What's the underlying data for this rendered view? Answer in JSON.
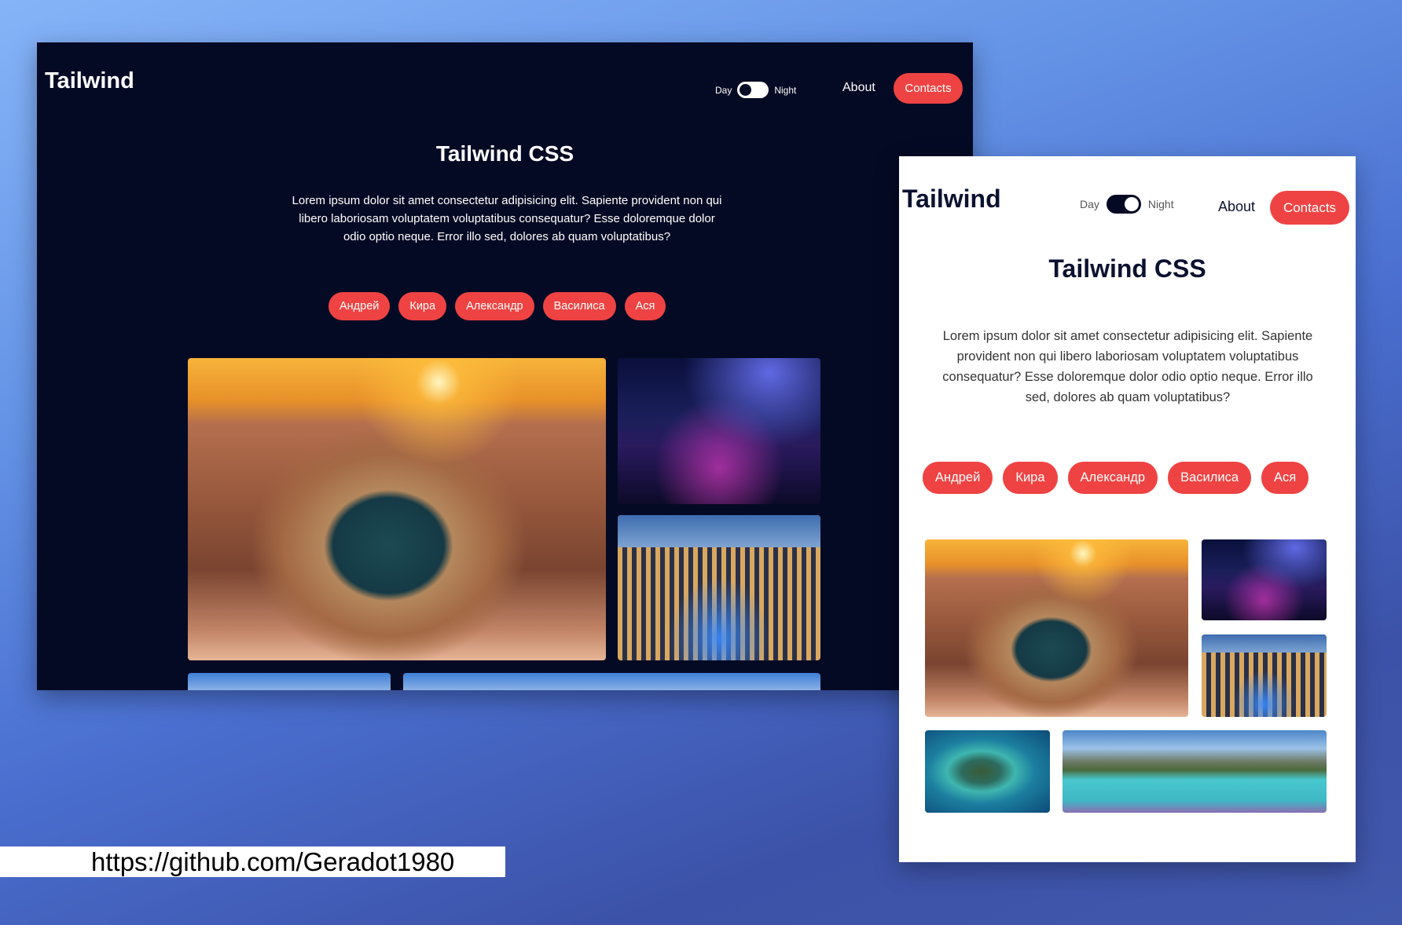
{
  "dark_window": {
    "logo": "Tailwind",
    "toggle": {
      "day_label": "Day",
      "night_label": "Night",
      "state": "night"
    },
    "nav": {
      "about": "About",
      "contacts": "Contacts"
    },
    "title": "Tailwind CSS",
    "description": "Lorem ipsum dolor sit amet consectetur adipisicing elit. Sapiente provident non qui libero laboriosam voluptatem voluptatibus consequatur? Esse doloremque dolor odio optio neque. Error illo sed, dolores ab quam voluptatibus?",
    "chips": [
      "Андрей",
      "Кира",
      "Александр",
      "Василиса",
      "Ася"
    ],
    "colors": {
      "background": "#050a24",
      "accent": "#ef4343",
      "text": "#ffffff"
    }
  },
  "light_window": {
    "logo": "Tailwind",
    "toggle": {
      "day_label": "Day",
      "night_label": "Night",
      "state": "day"
    },
    "nav": {
      "about": "About",
      "contacts": "Contacts"
    },
    "title": "Tailwind CSS",
    "description": "Lorem ipsum dolor sit amet consectetur adipisicing elit. Sapiente provident non qui libero laboriosam voluptatem voluptatibus consequatur? Esse doloremque dolor odio optio neque. Error illo sed, dolores ab quam voluptatibus?",
    "chips": [
      "Андрей",
      "Кира",
      "Александр",
      "Василиса",
      "Ася"
    ],
    "colors": {
      "background": "#ffffff",
      "accent": "#ef4343",
      "text": "#0b1230"
    }
  },
  "footer": {
    "url": "https://github.com/Geradot1980"
  }
}
